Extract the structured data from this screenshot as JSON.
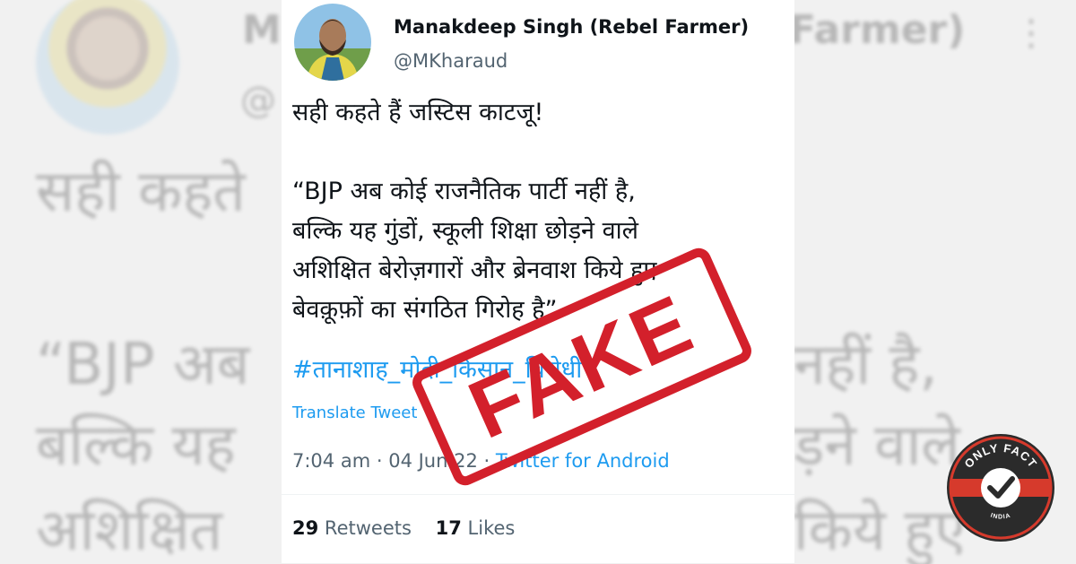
{
  "author": {
    "name": "Manakdeep Singh (Rebel Farmer)",
    "handle": "@MKharaud"
  },
  "tweet": {
    "lines": [
      "सही कहते हैं जस्टिस काटजू!",
      "“BJP अब कोई राजनैतिक पार्टी नहीं है,",
      "बल्कि यह गुंडों, स्कूली शिक्षा छोड़ने वाले",
      "अशिक्षित बेरोज़गारों और ब्रेनवाश किये हुए",
      "बेवक़ूफ़ों का संगठित गिरोह है”"
    ],
    "hashtags": "#तानाशाह_मोदी_किसान_विरोधी",
    "translate_label": "Translate Tweet",
    "time": "7:04 am",
    "date": "04 Jun 22",
    "source": "Twitter for Android",
    "retweets_count": "29",
    "retweets_label": "Retweets",
    "likes_count": "17",
    "likes_label": "Likes"
  },
  "background_echo": {
    "name_left": "M",
    "name_right": "Farmer)",
    "handle": "@",
    "line1": "सही कहते",
    "line2_left": "“BJP अब",
    "line2_right": "नहीं है,",
    "line3_left": "बल्कि यह",
    "line3_right": "ड़ने वाले",
    "line4_left": "अशिक्षित",
    "line4_right": "किये हुए",
    "more_icon": "⋮"
  },
  "stamp": {
    "text": "FAKE",
    "color": "#d3202b"
  },
  "logo": {
    "top_text": "ONLY FACT",
    "bottom_text": "INDIA",
    "icon": "checkmark-icon"
  },
  "colors": {
    "link": "#1d9bf0",
    "text": "#0f1419",
    "muted": "#536471"
  }
}
